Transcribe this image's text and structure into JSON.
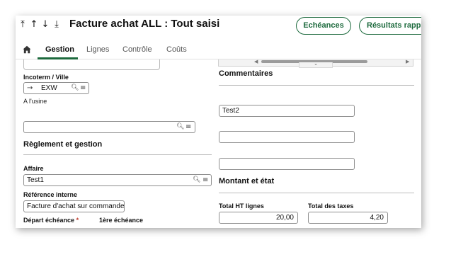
{
  "header": {
    "nav_arrows": [
      "⤒",
      "↑",
      "↓",
      "⤓"
    ],
    "title": "Facture achat ALL : Tout saisi",
    "buttons": [
      "Echéances",
      "Résultats rappro"
    ]
  },
  "tabs": [
    "Gestion",
    "Lignes",
    "Contrôle",
    "Coûts"
  ],
  "left": {
    "incoterm_label": "Incoterm / Ville",
    "incoterm_value": "EXW",
    "incoterm_desc": "A l'usine",
    "reglement_section": "Règlement et gestion",
    "affaire_label": "Affaire",
    "affaire_value": "Test1",
    "ref_label": "Référence interne",
    "ref_value": "Facture d'achat sur commande",
    "depart_label": "Départ échéance",
    "required_mark": "*",
    "premiere_label": "1ère échéance"
  },
  "right": {
    "commentaires_section": "Commentaires",
    "comment_1": "Test2",
    "comment_2": "",
    "comment_3": "",
    "montant_section": "Montant et état",
    "total_ht_label": "Total HT lignes",
    "total_ht_value": "20,00",
    "total_taxes_label": "Total des taxes",
    "total_taxes_value": "4,20"
  },
  "icons": [
    "arrow-right-icon",
    "search-icon",
    "list-icon",
    "home-icon"
  ]
}
